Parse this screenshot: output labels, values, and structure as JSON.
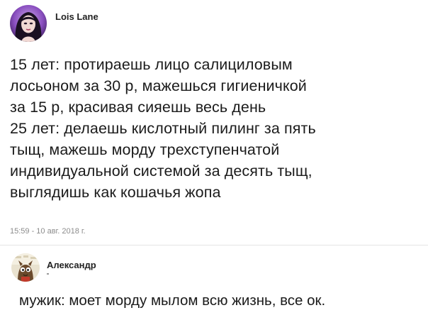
{
  "post": {
    "author": "Lois Lane",
    "avatar_icon": "user-avatar-photo",
    "lines": [
      "15 лет: протираешь лицо салициловым",
      "лосьоном за 30 р, мажешься гигиеничкой",
      "за 15 р, красивая сияешь весь день",
      "25 лет: делаешь кислотный пилинг за пять",
      "тыщ, мажешь морду трехступенчатой",
      "индивидуальной системой за десять тыщ,",
      "выглядишь как кошачья жопа"
    ],
    "timestamp": "15:59 - 10 авг. 2018 г."
  },
  "comment": {
    "author": "Александр",
    "avatar_icon": "user-avatar-cartoon",
    "text": "мужик: моет морду мылом всю жизнь, все ок."
  }
}
